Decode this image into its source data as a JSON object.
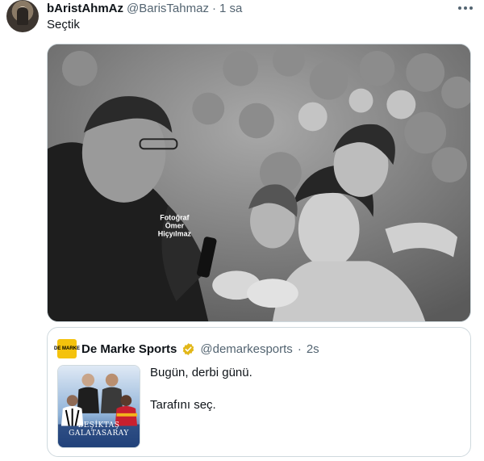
{
  "tweet": {
    "display_name": "bAristAhmAz",
    "handle": "@BarisTahmaz",
    "separator": "·",
    "time": "1 sa",
    "text": "Seçtik",
    "photo_watermark": [
      "Fotoğraf",
      "Ömer",
      "Hiçyılmaz"
    ]
  },
  "quote": {
    "avatar_text": "DE MARKE",
    "display_name": "De Marke Sports",
    "handle": "@demarkesports",
    "separator": "·",
    "time": "2s",
    "line1": "Bugün, derbi günü.",
    "line2": "Tarafını seç.",
    "thumb_title_1": "BEŞİKTAŞ",
    "thumb_title_2": "GALATASARAY"
  },
  "icons": {
    "more": "more-dots-icon",
    "verified": "verified-badge-icon"
  },
  "colors": {
    "text_primary": "#0f1419",
    "text_secondary": "#536471",
    "border": "#cfd9de",
    "verified_gold": "#e2b719",
    "brand_yellow": "#f4c20d"
  }
}
